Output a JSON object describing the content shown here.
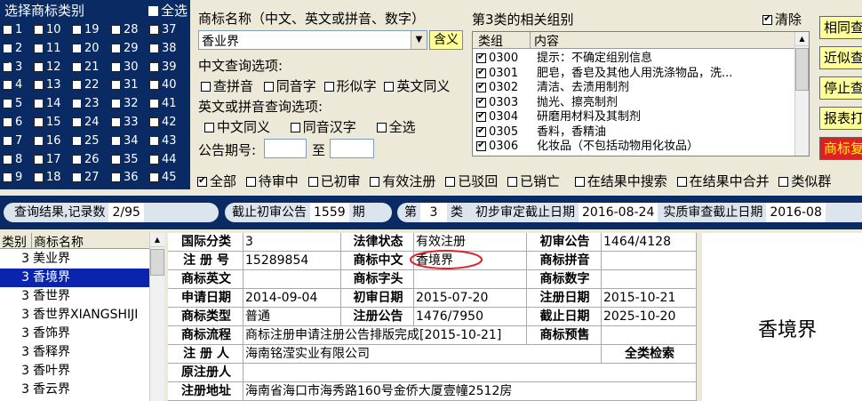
{
  "left_panel": {
    "title": "选择商标类别",
    "select_all": "全选",
    "columns": [
      [
        "1",
        "2",
        "3",
        "4",
        "5",
        "6",
        "7",
        "8",
        "9"
      ],
      [
        "10",
        "11",
        "12",
        "13",
        "14",
        "15",
        "16",
        "17",
        "18"
      ],
      [
        "19",
        "20",
        "21",
        "22",
        "23",
        "24",
        "25",
        "26",
        "27"
      ],
      [
        "28",
        "29",
        "30",
        "31",
        "32",
        "33",
        "34",
        "35",
        "36"
      ],
      [
        "37",
        "38",
        "39",
        "40",
        "41",
        "42",
        "43",
        "44",
        "45"
      ]
    ],
    "checked": "3"
  },
  "search": {
    "name_label": "商标名称（中文、英文或拼音、数字）",
    "name_value": "香业界",
    "hanyi_button": "含义",
    "cn_options_label": "中文查询选项:",
    "cn_options": [
      "查拼音",
      "同音字",
      "形似字",
      "英文同义"
    ],
    "en_options_label": "英文或拼音查询选项:",
    "en_options": [
      "中文同义",
      "同音汉字",
      "全选"
    ],
    "period_label": "公告期号:",
    "period_to": "至"
  },
  "groups": {
    "title": "第3类的相关组别",
    "clear_label": "清除",
    "col_group": "类组",
    "col_content": "内容",
    "rows": [
      {
        "code": "0300",
        "text": "提示：不确定组别信息"
      },
      {
        "code": "0301",
        "text": "肥皂，香皂及其他人用洗涤物品，洗..."
      },
      {
        "code": "0302",
        "text": "清洁、去渍用制剂"
      },
      {
        "code": "0303",
        "text": "抛光、擦亮制剂"
      },
      {
        "code": "0304",
        "text": "研磨用材料及其制剂"
      },
      {
        "code": "0305",
        "text": "香料，香精油"
      },
      {
        "code": "0306",
        "text": "化妆品（不包括动物用化妆品）"
      }
    ]
  },
  "right_buttons": [
    "相同查询",
    "近似查询",
    "停止查询",
    "报表打印",
    "商标复制"
  ],
  "filters": [
    "全部",
    "待审中",
    "已初审",
    "有效注册",
    "已驳回",
    "已销亡",
    "在结果中搜索",
    "在结果中合并",
    "类似群"
  ],
  "status_bar": {
    "results_label": "查询结果,记录数",
    "results_value": "2/95",
    "cutoff_label": "截止初审公告",
    "cutoff_value": "1559",
    "cutoff_unit": "期",
    "class_prefix": "第",
    "class_value": "3",
    "class_suffix": "类",
    "prelim_label": "初步审定截止日期",
    "prelim_value": "2016-08-24",
    "exam_label": "实质审查截止日期",
    "exam_value": "2016-08"
  },
  "results": {
    "col_class": "类别",
    "col_name": "商标名称",
    "rows": [
      {
        "cls": "3",
        "name": "美业界"
      },
      {
        "cls": "3",
        "name": "香境界"
      },
      {
        "cls": "3",
        "name": "香世界"
      },
      {
        "cls": "3",
        "name": "香世界XIANGSHIJI"
      },
      {
        "cls": "3",
        "name": "香饰界"
      },
      {
        "cls": "3",
        "name": "香释界"
      },
      {
        "cls": "3",
        "name": "香叶界"
      },
      {
        "cls": "3",
        "name": "香云界"
      }
    ],
    "selected_index": 1
  },
  "detail": {
    "intl_class_label": "国际分类",
    "intl_class": "3",
    "legal_status_label": "法律状态",
    "legal_status": "有效注册",
    "prelim_pub_label": "初审公告",
    "prelim_pub": "1464/4128",
    "reg_no_label": "注 册 号",
    "reg_no": "15289854",
    "cn_name_label": "商标中文",
    "cn_name": "香境界",
    "pinyin_label": "商标拼音",
    "pinyin": "",
    "en_name_label": "商标英文",
    "en_name": "",
    "initials_label": "商标字头",
    "initials": "",
    "digits_label": "商标数字",
    "digits": "",
    "apply_date_label": "申请日期",
    "apply_date": "2014-09-04",
    "prelim_date_label": "初审日期",
    "prelim_date": "2015-07-20",
    "reg_date_label": "注册日期",
    "reg_date": "2015-10-21",
    "type_label": "商标类型",
    "type": "普通",
    "reg_pub_label": "注册公告",
    "reg_pub": "1476/7950",
    "expiry_label": "截止日期",
    "expiry": "2025-10-20",
    "flow_label": "商标流程",
    "flow": "商标注册申请注册公告排版完成[2015-10-21]",
    "warning_label": "商标预售",
    "registrant_label": "注 册 人",
    "registrant": "海南铭滢实业有限公司",
    "full_search": "全类检索",
    "orig_registrant_label": "原注册人",
    "orig_registrant": "",
    "address_label": "注册地址",
    "address": "海南省海口市海秀路160号金侨大厦壹幢2512房"
  },
  "preview": {
    "text": "香境界"
  },
  "colors": {
    "navy": "#0a2a63",
    "selection": "#0a24b0",
    "accent_yellow": "#ffff99",
    "annotation_red": "#e0202a"
  }
}
